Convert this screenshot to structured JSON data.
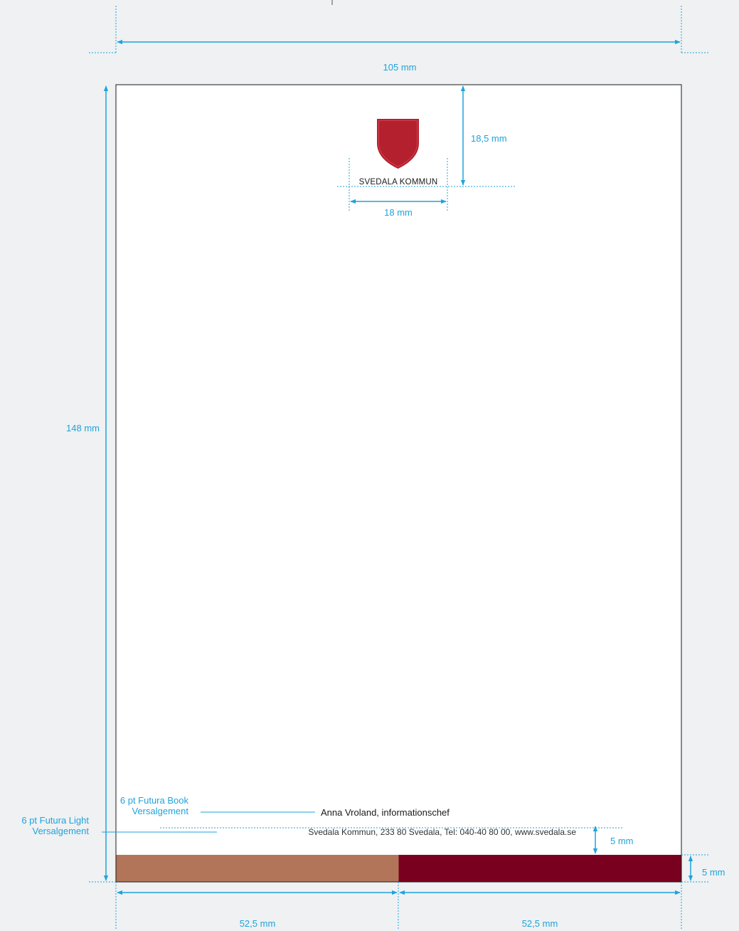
{
  "colors": {
    "background": "#eff1f2",
    "paper": "#ffffff",
    "dimension": "#1fa3dc",
    "text": "#1a1a1a",
    "band_left": "#b3755a",
    "band_right": "#7a0020",
    "shield": "#b5202e",
    "leaf": "#f3c01b"
  },
  "dimensions": {
    "paper_width": "105 mm",
    "paper_height": "148 mm",
    "logo_top": "18,5 mm",
    "logo_width": "18 mm",
    "text_to_band": "5 mm",
    "band_height": "5 mm",
    "band_left_width": "52,5 mm",
    "band_right_width": "52,5 mm"
  },
  "annotations": {
    "name_font": {
      "line1": "6 pt Futura Book",
      "line2": "Versalgement"
    },
    "address_font": {
      "line1": "6 pt Futura Light",
      "line2": "Versalgement"
    }
  },
  "document": {
    "logo_text": "SVEDALA KOMMUN",
    "logo_icon": "coat-of-arms-icon",
    "name_line": "Anna Vroland, informationschef",
    "address_line": "Svedala Kommun, 233 80 Svedala, Tel: 040-40 80 00, www.svedala.se"
  }
}
